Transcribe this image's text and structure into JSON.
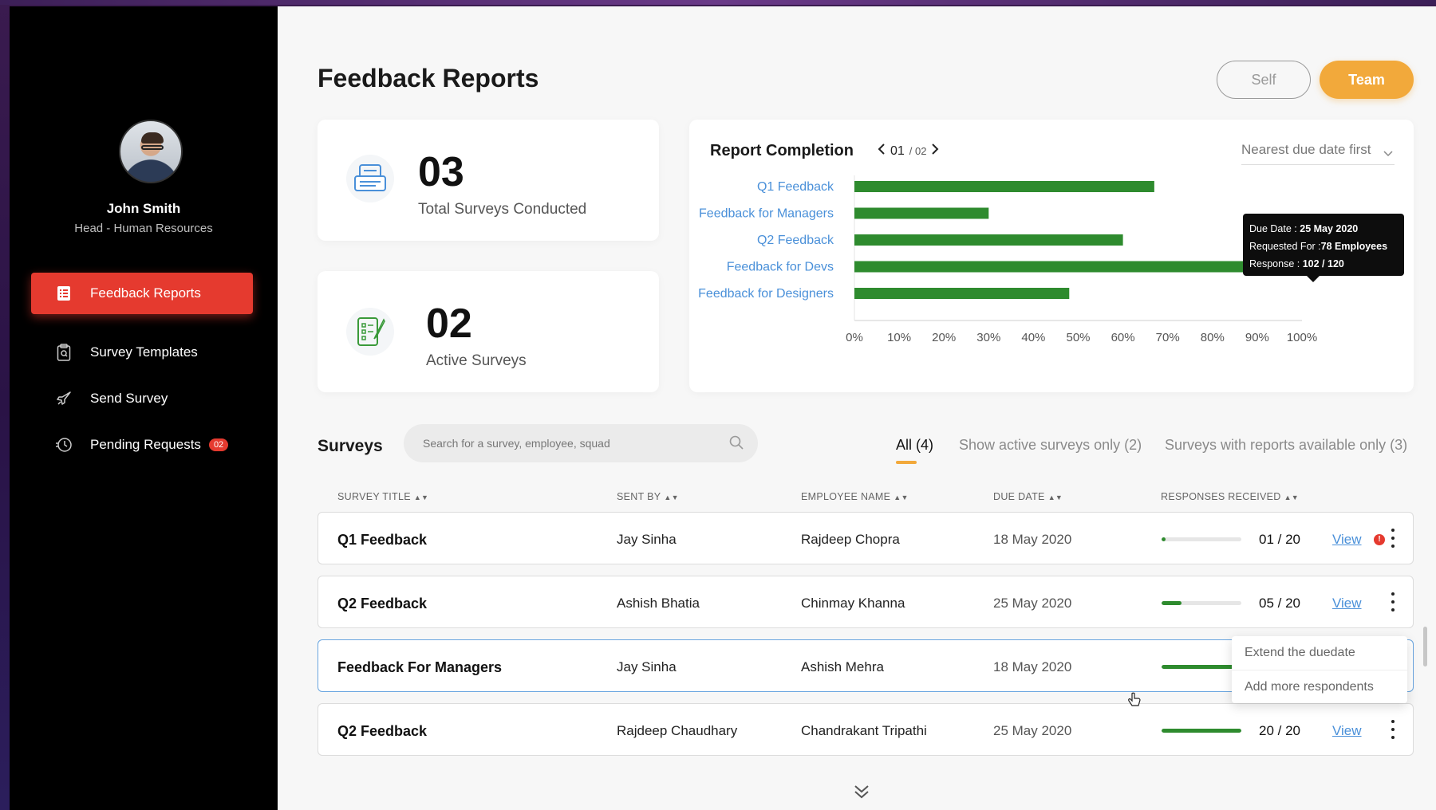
{
  "user": {
    "name": "John Smith",
    "role": "Head - Human Resources"
  },
  "sidebar": {
    "items": [
      {
        "label": "Feedback Reports",
        "icon": "report-icon",
        "active": true
      },
      {
        "label": "Survey Templates",
        "icon": "clipboard-icon",
        "active": false
      },
      {
        "label": "Send Survey",
        "icon": "rocket-icon",
        "active": false
      },
      {
        "label": "Pending Requests",
        "icon": "history-icon",
        "active": false,
        "badge": "02"
      }
    ]
  },
  "header": {
    "title": "Feedback Reports",
    "self_label": "Self",
    "team_label": "Team"
  },
  "stats": [
    {
      "value": "03",
      "label": "Total Surveys Conducted",
      "icon": "survey-list-icon"
    },
    {
      "value": "02",
      "label": "Active Surveys",
      "icon": "checklist-pen-icon"
    }
  ],
  "report": {
    "title": "Report Completion",
    "page_current": "01",
    "page_total": "/ 02",
    "sort_label": "Nearest due date first",
    "tooltip": {
      "due_label": "Due Date :",
      "due_value": "25 May 2020",
      "requested_label": "Requested For :",
      "requested_value": "78 Employees",
      "response_label": "Response :",
      "response_value": "102 / 120"
    }
  },
  "chart_data": {
    "type": "bar",
    "orientation": "horizontal",
    "categories": [
      "Q1 Feedback",
      "Feedback for Managers",
      "Q2 Feedback",
      "Feedback for Devs",
      "Feedback for Designers"
    ],
    "values": [
      67,
      30,
      60,
      89,
      48
    ],
    "xlim": [
      0,
      100
    ],
    "x_ticks": [
      "0%",
      "10%",
      "20%",
      "30%",
      "40%",
      "50%",
      "60%",
      "70%",
      "80%",
      "90%",
      "100%"
    ],
    "bar_color": "#2e8b2e",
    "label_color": "#4a90d9"
  },
  "surveys": {
    "title": "Surveys",
    "search_placeholder": "Search for a survey, employee, squad",
    "filters": [
      {
        "label": "All (4)",
        "active": true
      },
      {
        "label": "Show active surveys only (2)",
        "active": false
      },
      {
        "label": "Surveys with reports available only (3)",
        "active": false
      }
    ],
    "columns": [
      "SURVEY TITLE",
      "SENT BY",
      "EMPLOYEE NAME",
      "DUE DATE",
      "RESPONSES RECEIVED"
    ],
    "rows": [
      {
        "title": "Q1 Feedback",
        "sent_by": "Jay Sinha",
        "employee": "Rajdeep Chopra",
        "due": "18 May 2020",
        "responses": "01 / 20",
        "progress": 0.05,
        "view": "View",
        "alert": "!"
      },
      {
        "title": "Q2 Feedback",
        "sent_by": "Ashish Bhatia",
        "employee": "Chinmay Khanna",
        "due": "25 May 2020",
        "responses": "05 / 20",
        "progress": 0.25,
        "view": "View"
      },
      {
        "title": "Feedback For Managers",
        "sent_by": "Jay Sinha",
        "employee": "Ashish Mehra",
        "due": "18 May 2020",
        "responses": "",
        "progress": 0.9,
        "view": ""
      },
      {
        "title": "Q2 Feedback",
        "sent_by": "Rajdeep Chaudhary",
        "employee": "Chandrakant Tripathi",
        "due": "25 May 2020",
        "responses": "20 / 20",
        "progress": 1.0,
        "view": "View"
      }
    ],
    "menu": [
      "Extend the duedate",
      "Add more respondents"
    ]
  }
}
